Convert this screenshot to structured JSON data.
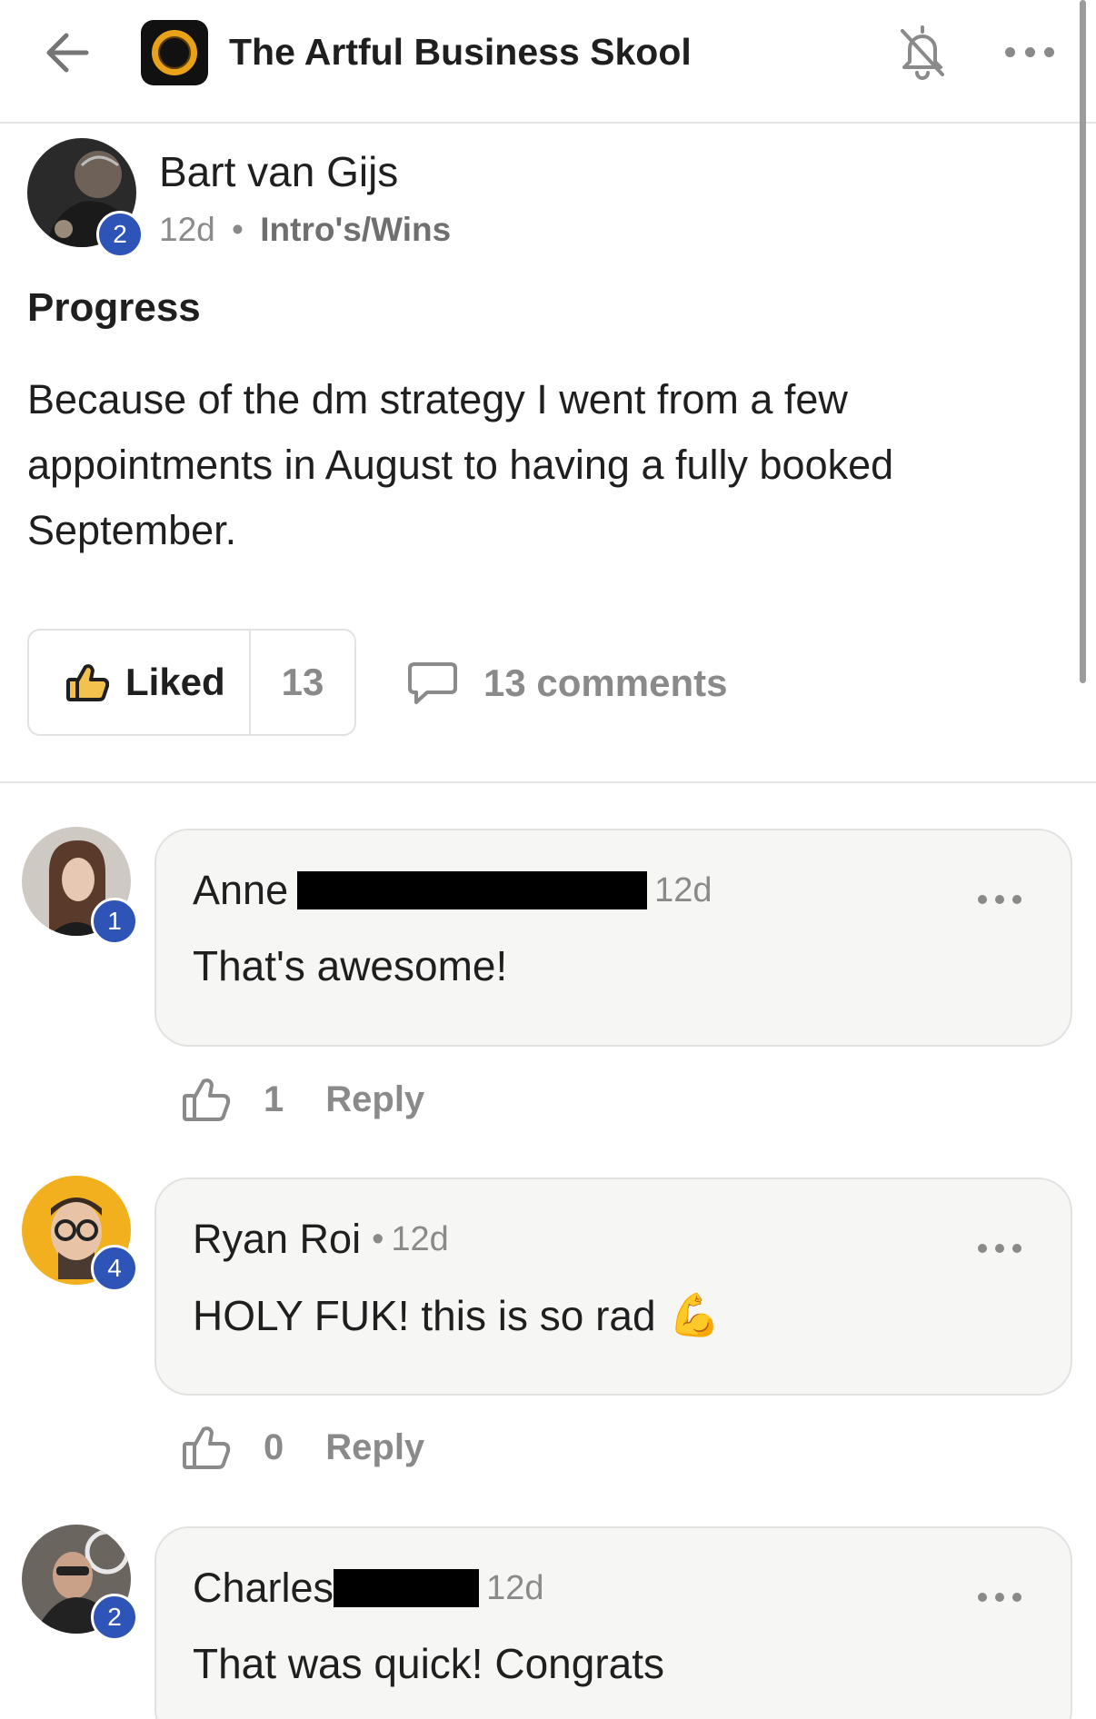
{
  "header": {
    "group_title": "The Artful Business Skool",
    "back_icon": "arrow-left-icon",
    "bell_icon": "bell-off-icon",
    "more_icon": "more-horizontal-icon"
  },
  "post": {
    "author": "Bart van Gijs",
    "level": "2",
    "time": "12d",
    "separator": "•",
    "category": "Intro's/Wins",
    "title": "Progress",
    "body": "Because of the dm strategy I went from a few appointments in August to having a fully booked September.",
    "like_label": "Liked",
    "like_count": "13",
    "comments_label": "13 comments"
  },
  "comments": [
    {
      "name": "Anne",
      "level": "1",
      "time": "12d",
      "text": "That's awesome!",
      "likes": "1",
      "reply_label": "Reply"
    },
    {
      "name": "Ryan Roi",
      "level": "4",
      "separator": "•",
      "time": "12d",
      "text": "HOLY FUK! this is so rad",
      "emoji": "💪",
      "likes": "0",
      "reply_label": "Reply"
    },
    {
      "name": "Charles",
      "level": "2",
      "time": "12d",
      "text": "That was quick! Congrats"
    }
  ],
  "colors": {
    "level_badge": "#2f54b8",
    "muted_text": "#8a8a8a",
    "bubble_bg": "#f6f6f5",
    "logo_ring": "#e8a21a"
  }
}
